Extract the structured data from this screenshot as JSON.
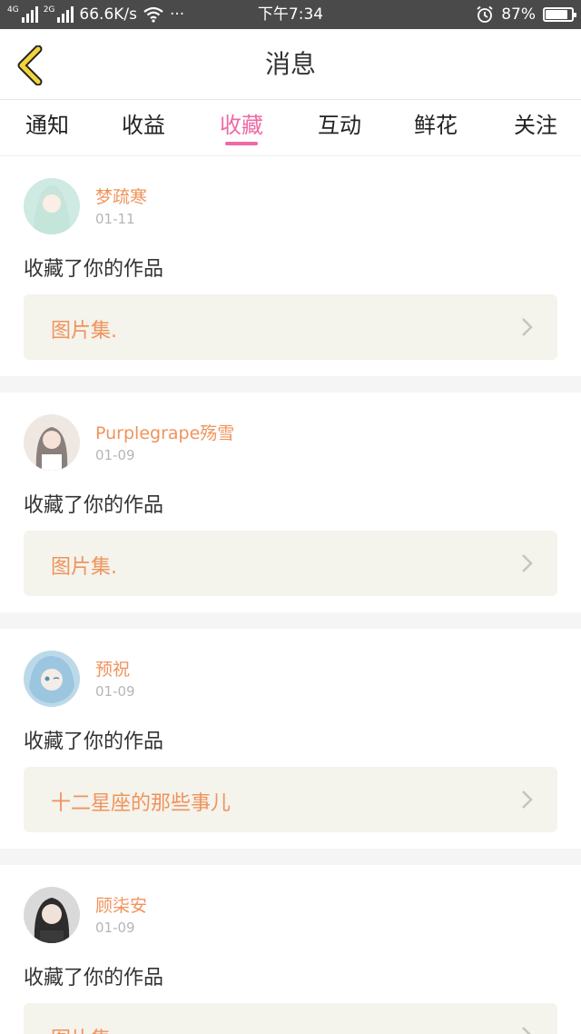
{
  "status_bar": {
    "net_1": "4G",
    "net_2": "2G",
    "speed": "66.6K/s",
    "dots": "···",
    "time": "下午7:34",
    "battery": "87%",
    "battery_level": 0.87
  },
  "header": {
    "title": "消息",
    "back_icon": "chevron-left-icon"
  },
  "tabs": [
    {
      "label": "通知"
    },
    {
      "label": "收益"
    },
    {
      "label": "收藏",
      "active": true
    },
    {
      "label": "互动"
    },
    {
      "label": "鲜花"
    },
    {
      "label": "关注"
    }
  ],
  "messages": [
    {
      "user": "梦疏寒",
      "date": "01-11",
      "action": "收藏了你的作品",
      "work": "图片集.",
      "avatar_color": "#a8d6c9"
    },
    {
      "user": "Purplegrape殇雪",
      "date": "01-09",
      "action": "收藏了你的作品",
      "work": "图片集.",
      "avatar_color": "#e8dcd6"
    },
    {
      "user": "预祝",
      "date": "01-09",
      "action": "收藏了你的作品",
      "work": "十二星座的那些事儿",
      "avatar_color": "#9fc7e0"
    },
    {
      "user": "顾柒安",
      "date": "01-09",
      "action": "收藏了你的作品",
      "work": "图片集.",
      "avatar_color": "#6e6e6e"
    }
  ],
  "colors": {
    "accent_pink": "#ee6aa5",
    "name_orange": "#f0935c",
    "back_yellow": "#f5d33b"
  }
}
